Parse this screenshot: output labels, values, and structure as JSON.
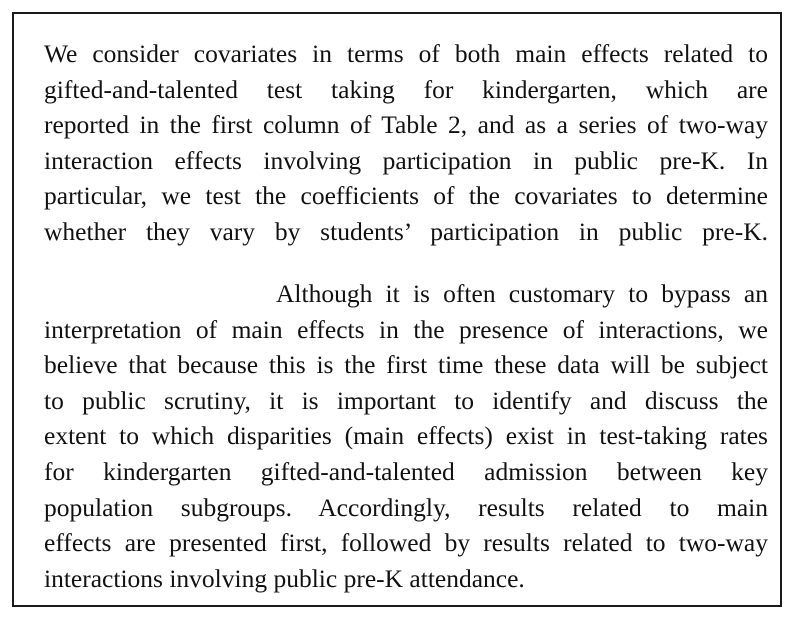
{
  "paragraphs": [
    {
      "lines": [
        "We consider covariates in terms of both main effects related to",
        "gifted-and-talented test taking for kindergarten, which are",
        "reported in the first column of Table 2, and as a series of two-way",
        "interaction effects involving participation in public pre-K. In",
        "particular, we test the coefficients of the covariates to determine",
        "whether they vary by students’ participation in public pre-K."
      ]
    },
    {
      "lines": [
        "Although it is often customary to bypass an",
        "interpretation of main effects in the presence of interactions, we",
        "believe that because this is the first time these data will be subject",
        "to public scrutiny, it is important to identify and discuss the",
        "extent to which disparities (main effects) exist in test-taking rates",
        "for kindergarten gifted-and-talented admission between key",
        "population subgroups. Accordingly, results related to main",
        "effects are presented first, followed by results related to two-way",
        "interactions involving public pre-K attendance."
      ]
    }
  ]
}
